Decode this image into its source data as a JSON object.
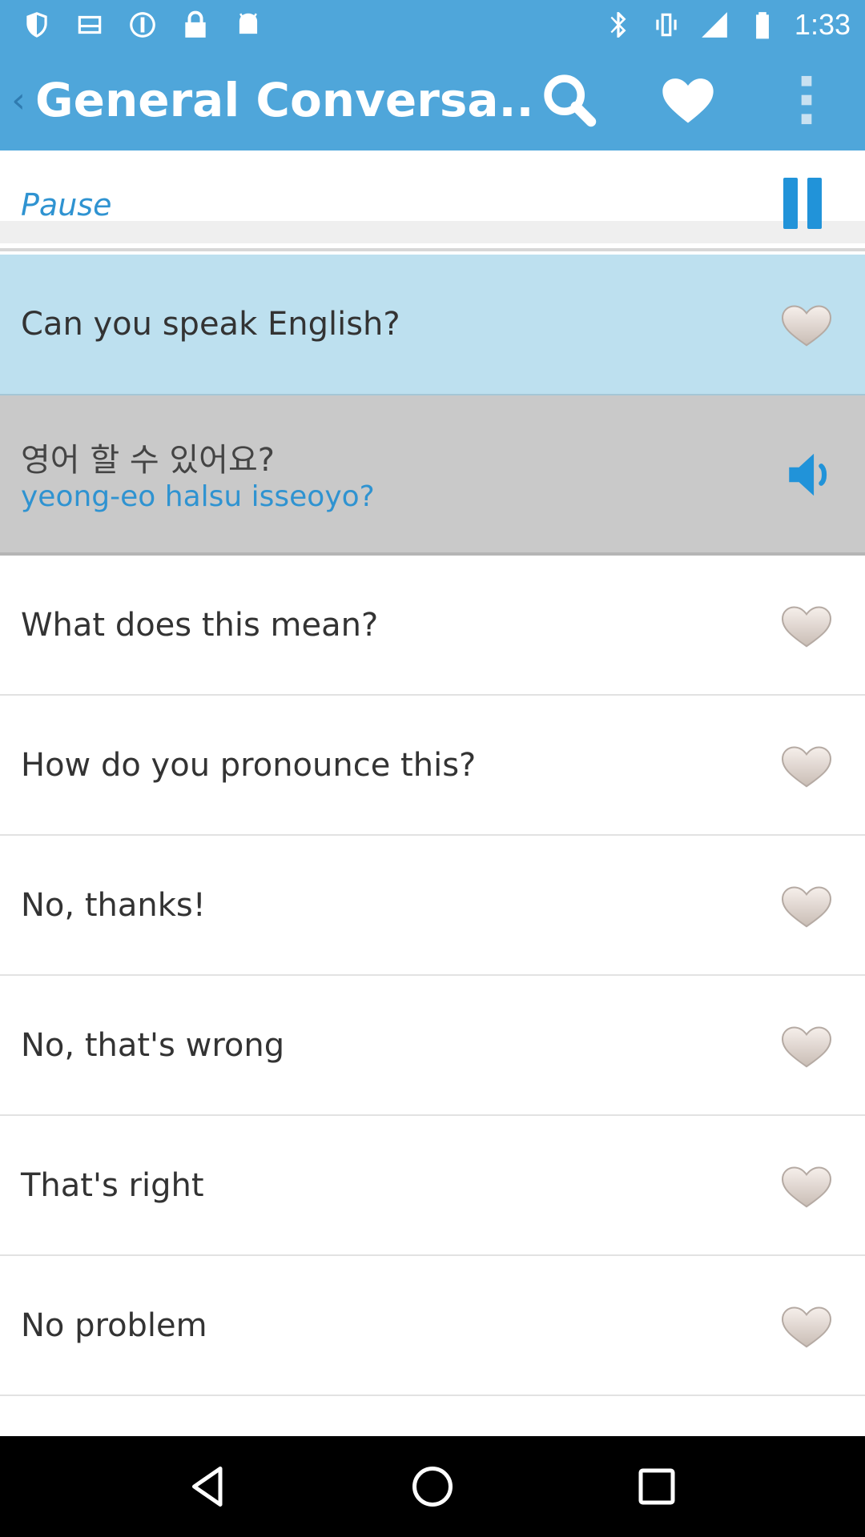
{
  "status_bar": {
    "time": "1:33",
    "left_icons": [
      "shield-icon",
      "notification-icon",
      "block-icon",
      "lock-icon",
      "android-icon"
    ],
    "right_icons": [
      "bluetooth-icon",
      "vibrate-icon",
      "signal-icon",
      "battery-icon"
    ]
  },
  "app_bar": {
    "title": "General Conversa...",
    "back_glyph": "‹",
    "actions": [
      "search-icon",
      "heart-icon",
      "overflow-menu-icon"
    ],
    "color": "#4fa6da"
  },
  "player": {
    "pause_label": "Pause",
    "accent": "#2193d9"
  },
  "phrases": {
    "selected": {
      "label": "Can you speak English?"
    },
    "translation": {
      "native": "영어 할 수 있어요?",
      "romanized": "yeong-eo halsu isseoyo?"
    },
    "items": [
      {
        "label": "What does this mean?"
      },
      {
        "label": "How do you pronounce this?"
      },
      {
        "label": "No, thanks!"
      },
      {
        "label": "No, that's wrong"
      },
      {
        "label": "That's right"
      },
      {
        "label": "No problem"
      }
    ]
  },
  "nav_bar": {
    "buttons": [
      "back-icon",
      "home-icon",
      "recents-icon"
    ]
  }
}
